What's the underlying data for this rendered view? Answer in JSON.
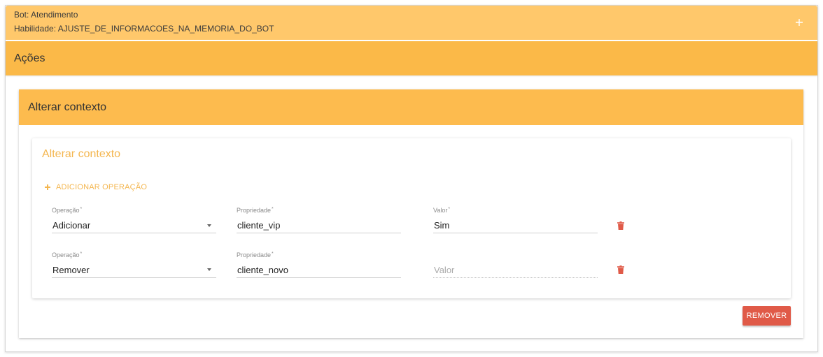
{
  "header": {
    "bot": "Bot: Atendimento",
    "skill": "Habilidade: AJUSTE_DE_INFORMACOES_NA_MEMORIA_DO_BOT",
    "expand_icon": "plus-icon"
  },
  "actions_section": {
    "title": "Ações"
  },
  "action_card": {
    "title": "Alterar contexto",
    "form_title": "Alterar contexto",
    "add_operation": {
      "icon": "plus-icon",
      "label": "ADICIONAR OPERAÇÃO"
    },
    "required_mark": "*",
    "operations": [
      {
        "operation": {
          "label": "Operação",
          "value": "Adicionar"
        },
        "property": {
          "label": "Propriedade",
          "value": "cliente_vip"
        },
        "value": {
          "label": "Valor",
          "value": "Sim"
        },
        "delete_icon": "trash-icon"
      },
      {
        "operation": {
          "label": "Operação",
          "value": "Remover"
        },
        "property": {
          "label": "Propriedade",
          "value": "cliente_novo"
        },
        "value": {
          "placeholder": "Valor"
        },
        "delete_icon": "trash-icon"
      }
    ],
    "remove_button": "REMOVER"
  },
  "colors": {
    "header_bg": "#FFC86B",
    "section_bg": "#FBB948",
    "card_header_bg": "#FDBB4E",
    "accent": "#F4B64F",
    "danger": "#E05A48"
  }
}
